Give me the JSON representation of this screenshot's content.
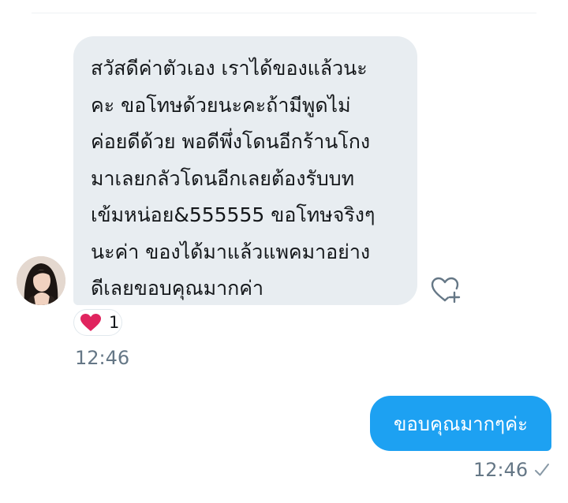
{
  "conversation": {
    "incoming_message": {
      "text": "สวัสดีค่าตัวเอง เราได้ของแล้วนะ\nคะ ขอโทษด้วยนะคะถ้ามีพูดไม่\nค่อยดีด้วย พอดีพึ่งโดนอีกร้านโกง\nมาเลยกลัวโดนอีกเลยต้องรับบท\nเข้มหน่อย&555555 ขอโทษจริงๆ\nนะค่า ของได้มาแล้วแพคมาอย่าง\nดีเลยขอบคุณมากค่า",
      "reaction_emoji": "red-heart",
      "reaction_count": "1",
      "timestamp": "12:46"
    },
    "outgoing_message": {
      "text": "ขอบคุณมากๆค่ะ",
      "timestamp": "12:46",
      "status_icon": "checkmark-icon"
    }
  },
  "colors": {
    "incoming_bubble": "#e8edf1",
    "outgoing_bubble": "#1da1f2",
    "timestamp": "#657786",
    "heart": "#e0245e"
  }
}
